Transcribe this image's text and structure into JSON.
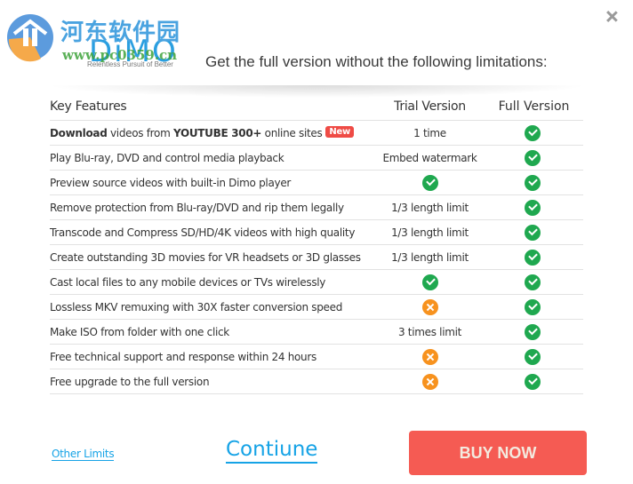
{
  "logo": {
    "watermark_cn": "河东软件园",
    "brand": "DiMO",
    "watermark_url": "www.pc0359.cn",
    "tagline": "Relentless Pursuit of Better"
  },
  "headline": "Get the full version without the following limitations:",
  "colors": {
    "accent_blue": "#16a3e6",
    "check_green": "#1fa84f",
    "cross_orange": "#f7921e",
    "buy_red": "#f55b53",
    "badge_red": "#ef4b45"
  },
  "table": {
    "headers": {
      "feature": "Key Features",
      "trial": "Trial Version",
      "full": "Full Version"
    },
    "rows": [
      {
        "feature_parts": [
          {
            "text": "Download",
            "bold": true
          },
          {
            "text": " videos from "
          },
          {
            "text": "YOUTUBE 300+",
            "bold": true
          },
          {
            "text": " online sites"
          }
        ],
        "badge": "New",
        "trial": {
          "type": "text",
          "value": "1  time"
        },
        "full": {
          "type": "check"
        }
      },
      {
        "feature": "Play Blu-ray, DVD and control media playback",
        "trial": {
          "type": "text",
          "value": "Embed watermark"
        },
        "full": {
          "type": "check"
        }
      },
      {
        "feature": "Preview source videos with built-in Dimo player",
        "trial": {
          "type": "check"
        },
        "full": {
          "type": "check"
        }
      },
      {
        "feature": "Remove protection from Blu-ray/DVD and rip them legally",
        "trial": {
          "type": "text",
          "value": "1/3 length limit"
        },
        "full": {
          "type": "check"
        }
      },
      {
        "feature": "Transcode and Compress SD/HD/4K videos with high quality",
        "trial": {
          "type": "text",
          "value": "1/3 length limit"
        },
        "full": {
          "type": "check"
        }
      },
      {
        "feature": "Create outstanding 3D movies for VR headsets or 3D glasses",
        "trial": {
          "type": "text",
          "value": "1/3 length limit"
        },
        "full": {
          "type": "check"
        }
      },
      {
        "feature": "Cast local files to any mobile devices or TVs wirelessly",
        "trial": {
          "type": "check"
        },
        "full": {
          "type": "check"
        }
      },
      {
        "feature": "Lossless MKV remuxing with 30X faster conversion speed",
        "trial": {
          "type": "cross"
        },
        "full": {
          "type": "check"
        }
      },
      {
        "feature": "Make ISO from folder with one click",
        "trial": {
          "type": "text",
          "value": "3 times limit"
        },
        "full": {
          "type": "check"
        }
      },
      {
        "feature": "Free technical support and response within 24 hours",
        "trial": {
          "type": "cross"
        },
        "full": {
          "type": "check"
        }
      },
      {
        "feature": "Free upgrade to the full version",
        "trial": {
          "type": "cross"
        },
        "full": {
          "type": "check"
        }
      }
    ]
  },
  "footer": {
    "other_limits": "Other Limits",
    "continue": "Contiune",
    "buy_now": "BUY NOW"
  }
}
